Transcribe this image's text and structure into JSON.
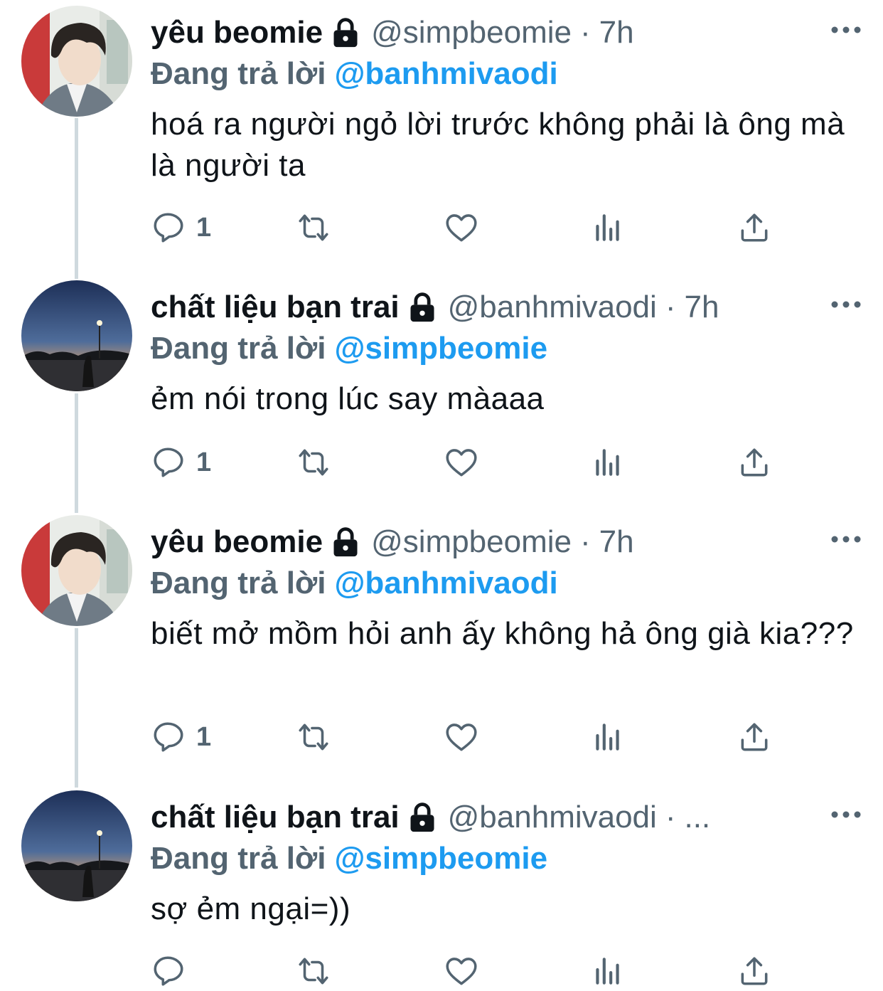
{
  "colors": {
    "accent": "#1d9bf0",
    "secondary_text": "#536471",
    "primary_text": "#0f1419",
    "thread_line": "#cfd9de"
  },
  "tweets": [
    {
      "name": "yêu beomie",
      "handle": "@simpbeomie",
      "separator": "·",
      "time": "7h",
      "replying_label": "Đang trả lời",
      "replying_to": "@banhmivaodi",
      "text": "hoá ra người ngỏ lời trước không phải là ông mà là người ta",
      "reply_count": "1",
      "avatar": "portrait-avatar"
    },
    {
      "name": "chất liệu bạn trai",
      "handle": "@banhmivaodi",
      "separator": "·",
      "time": "7h",
      "replying_label": "Đang trả lời",
      "replying_to": "@simpbeomie",
      "text": "ẻm nói trong lúc say màaaa",
      "reply_count": "1",
      "avatar": "dusk-avatar"
    },
    {
      "name": "yêu beomie",
      "handle": "@simpbeomie",
      "separator": "·",
      "time": "7h",
      "replying_label": "Đang trả lời",
      "replying_to": "@banhmivaodi",
      "text": "biết mở mồm hỏi anh ấy không hả ông già kia???",
      "reply_count": "1",
      "avatar": "portrait-avatar"
    },
    {
      "name": "chất liệu bạn trai",
      "handle": "@banhmivaodi",
      "separator": "·",
      "time": "...",
      "replying_label": "Đang trả lời",
      "replying_to": "@simpbeomie",
      "text": "sợ ẻm ngại=))",
      "reply_count": "",
      "avatar": "dusk-avatar"
    }
  ],
  "icons": {
    "lock": "lock-icon",
    "more": "more-icon",
    "reply": "reply-icon",
    "retweet": "retweet-icon",
    "like": "heart-icon",
    "analytics": "analytics-icon",
    "share": "share-icon"
  }
}
